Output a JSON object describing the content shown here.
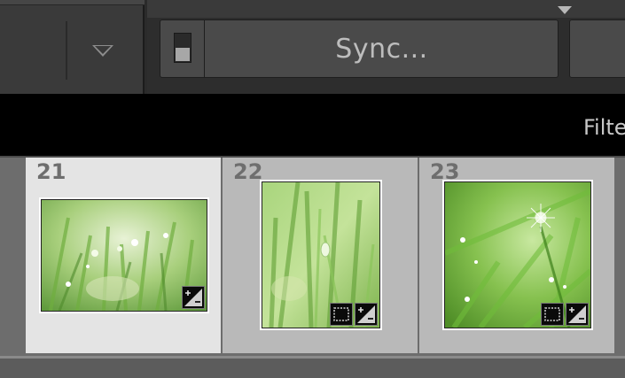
{
  "toolbar": {
    "menu_icon": "chevron-down-icon",
    "switch_icon": "auto-sync-switch-icon",
    "sync_label": "Sync...",
    "panel_menu_icon": "triangle-down-icon"
  },
  "filter_bar": {
    "label": "Filte"
  },
  "filmstrip": {
    "cells": [
      {
        "number": "21",
        "selected": true,
        "badges": [
          "exposure-adjusted-icon"
        ]
      },
      {
        "number": "22",
        "selected": false,
        "badges": [
          "crop-icon",
          "exposure-adjusted-icon"
        ]
      },
      {
        "number": "23",
        "selected": false,
        "badges": [
          "crop-icon",
          "exposure-adjusted-icon"
        ]
      }
    ]
  },
  "colors": {
    "selected_cell": "#e4e4e4",
    "cell": "#b9b9b9",
    "filter_bar": "#000000"
  }
}
